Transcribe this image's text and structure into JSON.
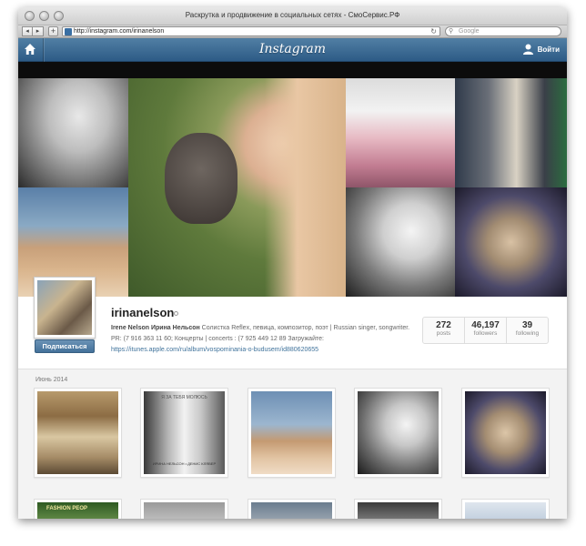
{
  "browser": {
    "window_title": "Раскрутка и продвижение в социальных сетях - СмоСервис.РФ",
    "url": "http://instagram.com/irinanelson",
    "search_placeholder": "Google",
    "back_icon": "back-arrow-icon",
    "forward_icon": "forward-arrow-icon"
  },
  "header": {
    "logo": "Instagram",
    "login_label": "Войти",
    "home_icon": "home-icon",
    "user_icon": "user-icon"
  },
  "profile": {
    "username": "irinanelson",
    "bio_name": "Irene Nelson Ирина Нельсон",
    "bio_text": " Солистка Reflex, певица, композитор, поэт | Russian singer, songwriter. PR: (7 916 363 11 60; Концерты | concerts : (7 925 449 12 89 Загружайте:",
    "bio_link": "https://itunes.apple.com/ru/album/vospominania-o-budusem/id880620655",
    "subscribe_label": "Подписаться",
    "stats": [
      {
        "value": "272",
        "label": "posts"
      },
      {
        "value": "46,197",
        "label": "followers"
      },
      {
        "value": "39",
        "label": "following"
      }
    ]
  },
  "feed": {
    "month_label": "Июнь 2014",
    "photo2_caption": "Я ЗА ТЕБЯ МОЛЮСЬ",
    "photo2_footer": "ИРИНА НЕЛЬСОН • ДЕНИС КЛЯВЕР",
    "row2_photo1_caption": "FASHION PEOP"
  },
  "colors": {
    "header_blue": "#3f729b",
    "link_blue": "#3f729b",
    "background": "#f3f3f3"
  }
}
